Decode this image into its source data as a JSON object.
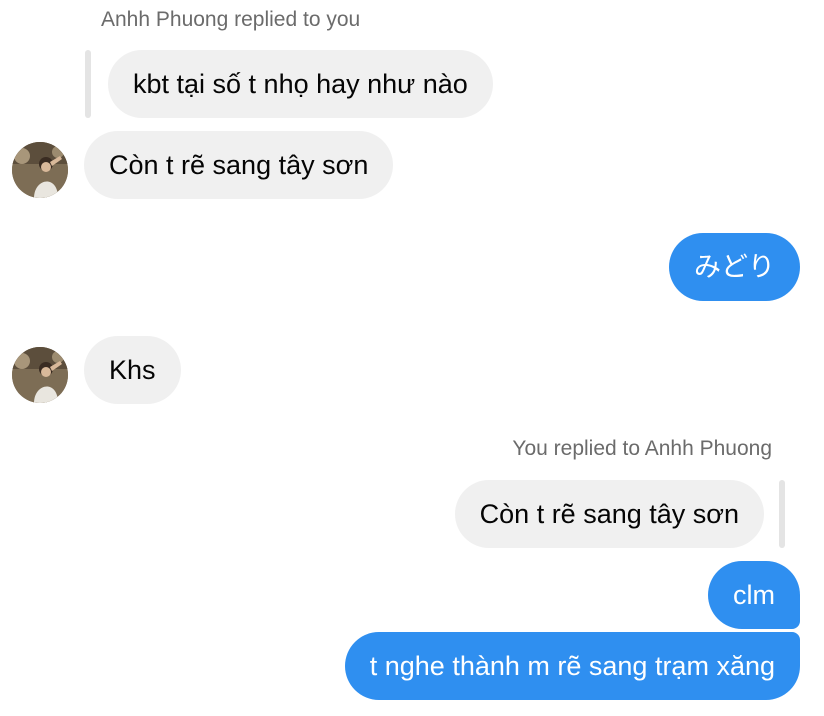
{
  "thread": {
    "reply_label_1": "Anhh Phuong replied to you",
    "quoted_message_1": "kbt tại số t nhọ hay như nào",
    "message_1": "Còn t rẽ sang tây sơn",
    "message_2": "みどり",
    "message_3": "Khs",
    "reply_label_2": "You replied to Anhh Phuong",
    "quoted_message_2": "Còn t rẽ sang tây sơn",
    "message_4": "clm",
    "message_5": "t nghe thành m rẽ sang trạm xăng"
  },
  "colors": {
    "outgoing_bubble": "#2f8ff0",
    "incoming_bubble": "#f0f0f0",
    "meta_text": "#6b6b6b"
  }
}
